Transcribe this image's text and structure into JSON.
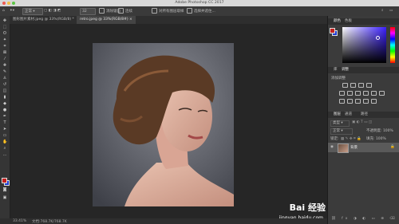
{
  "app": {
    "title": "Adobe Photoshop CC 2017"
  },
  "options_bar": {
    "mode": "正常",
    "tolerance": "32",
    "checkbox1": "消除锯齿",
    "checkbox2": "连续",
    "sample_all": "对所有图层取样",
    "refine": "选择并遮住..."
  },
  "tabs": [
    {
      "label": "图形图片素材.jpeg @ 33%(RGB/8) *"
    },
    {
      "label": "retro.jpeg @ 33%(RGB/8#) ×"
    }
  ],
  "status": {
    "zoom": "33.41%",
    "doc": "文档:768.7K/768.7K"
  },
  "panels": {
    "color": {
      "tab1": "颜色",
      "tab2": "色板"
    },
    "adjustments": {
      "tab1": "库",
      "tab2": "调整",
      "title": "添加调整"
    },
    "layers": {
      "tab1": "图层",
      "tab2": "通道",
      "tab3": "路径",
      "filter": "类型",
      "mode": "正常",
      "opacity": "不透明度: 100%",
      "fill": "填充: 100%",
      "lock": "锁定:",
      "layer_name": "背景"
    }
  },
  "watermark": {
    "text": "Bai 经验",
    "url": "jingyan.baidu.com"
  },
  "colors": {
    "foreground": "#c5201f",
    "background": "#1e3cd0"
  }
}
